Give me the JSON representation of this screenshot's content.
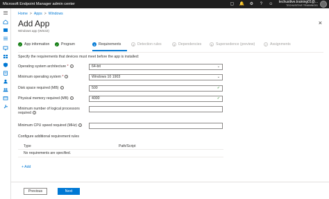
{
  "topbar": {
    "title": "Microsoft Endpoint Manager admin center",
    "user_line1": "techusitive.training01@...",
    "user_line2": "TECHUSITIVE TRAINING01"
  },
  "breadcrumb": {
    "items": [
      "Home",
      "Apps",
      "Windows"
    ],
    "separator": ">"
  },
  "page": {
    "title": "Add App",
    "subtitle": "Windows app (Win32)",
    "close": "×"
  },
  "steps": [
    {
      "label": "App information",
      "state": "done",
      "marker": "✓"
    },
    {
      "label": "Program",
      "state": "done",
      "marker": "✓"
    },
    {
      "label": "Requirements",
      "state": "current",
      "marker": "3"
    },
    {
      "label": "Detection rules",
      "state": "todo",
      "marker": "4"
    },
    {
      "label": "Dependencies",
      "state": "todo",
      "marker": "5"
    },
    {
      "label": "Supersedence (preview)",
      "state": "todo",
      "marker": "6"
    },
    {
      "label": "Assignments",
      "state": "todo",
      "marker": "7"
    }
  ],
  "requirements": {
    "intro": "Specify the requirements that devices must meet before the app is installed:",
    "fields": [
      {
        "label": "Operating system architecture",
        "required": "*",
        "value": "64-bit",
        "kind": "select"
      },
      {
        "label": "Minimum operating system",
        "required": "*",
        "value": "Windows 10 1903",
        "kind": "select"
      },
      {
        "label": "Disk space required (MB)",
        "required": "",
        "value": "500",
        "kind": "text-valid"
      },
      {
        "label": "Physical memory required (MB)",
        "required": "",
        "value": "4000",
        "kind": "text-valid"
      },
      {
        "label": "Minimum number of logical processors required",
        "required": "",
        "value": "",
        "kind": "text"
      },
      {
        "label": "Minimum CPU speed required (MHz)",
        "required": "",
        "value": "",
        "kind": "text"
      }
    ],
    "additional_label": "Configure additional requirement rules",
    "table": {
      "columns": [
        "Type",
        "Path/Script"
      ],
      "empty_text": "No requirements are specified."
    },
    "add_link": "+ Add"
  },
  "footer": {
    "previous": "Previous",
    "next": "Next"
  },
  "colors": {
    "accent": "#0078d4",
    "success": "#107c10",
    "topbar": "#1f1f1f"
  }
}
